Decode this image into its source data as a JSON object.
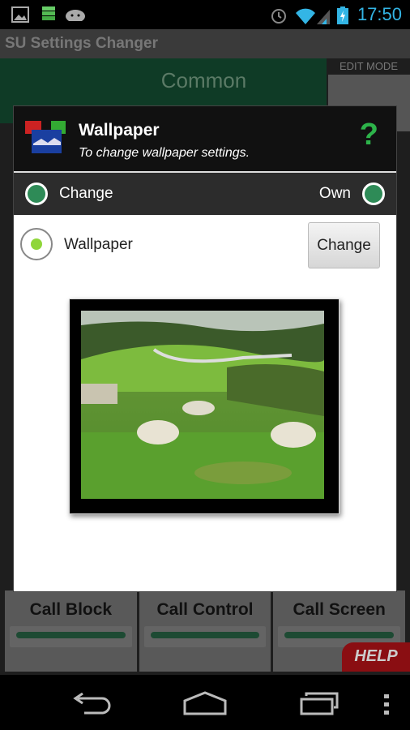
{
  "status_bar": {
    "time": "17:50",
    "icons": [
      "image-icon",
      "storage-icon",
      "android-icon",
      "alarm-icon",
      "wifi-icon",
      "signal-icon",
      "battery-charging-icon"
    ]
  },
  "app": {
    "title": "SU Settings Changer",
    "category": "Common",
    "edit_mode": "EDIT MODE"
  },
  "dialog": {
    "title": "Wallpaper",
    "subtitle": "To change wallpaper settings.",
    "help_icon": "?",
    "mode_left": "Change",
    "mode_right": "Own",
    "item_label": "Wallpaper",
    "change_button": "Change"
  },
  "tiles": [
    {
      "label": "Call Block"
    },
    {
      "label": "Call Control"
    },
    {
      "label": "Call Screen"
    }
  ],
  "help_label": "HELP",
  "colors": {
    "accent": "#2e8b57",
    "clock": "#33b5e5",
    "help": "#8a0e12"
  }
}
